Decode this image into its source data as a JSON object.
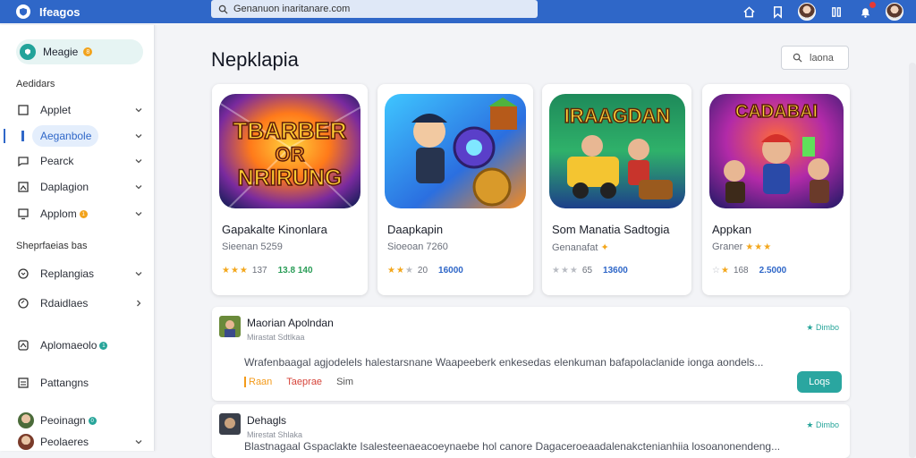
{
  "topbar": {
    "brand": "Ifeagos",
    "search_value": "Genanuon inaritanare.com",
    "icons": [
      "home-icon",
      "bookmark-icon",
      "user-avatar",
      "library-icon",
      "notification-icon",
      "profile-avatar"
    ]
  },
  "sidebar": {
    "header_label": "Meagie",
    "header_badge": "8",
    "section1": "Aedidars",
    "items": [
      {
        "label": "Applet",
        "icon": "square-icon"
      },
      {
        "label": "Aeganbole",
        "icon": "bar-icon",
        "active": true
      },
      {
        "label": "Pearck",
        "icon": "chat-icon"
      },
      {
        "label": "Daplagion",
        "icon": "image-icon"
      },
      {
        "label": "Applom",
        "icon": "monitor-icon",
        "badge": "1"
      }
    ],
    "section2": "Sheprfaeias bas",
    "items2": [
      {
        "label": "Replangias",
        "icon": "refresh-icon"
      },
      {
        "label": "Rdaidlaes",
        "icon": "chat-bubble-icon"
      },
      {
        "label": "Aplomaeolo",
        "icon": "app-icon",
        "badge": "1"
      },
      {
        "label": "Pattangns",
        "icon": "doc-icon"
      },
      {
        "label": "Peoinagn",
        "badge": "0"
      },
      {
        "label": "Peolaeres"
      }
    ]
  },
  "main": {
    "title": "Nepklapia",
    "sort_label": "laona"
  },
  "cards": [
    {
      "title": "Gapakalte Kinonlara",
      "sub": "Sieenan  5259",
      "rating": "137",
      "stars_on": 3,
      "downloads": "13.8 140",
      "dl_color": "#2a9d57",
      "art_title": "TBAREER OR NRIRUNG"
    },
    {
      "title": "Daapkapin",
      "sub": "Sioeoan  7260",
      "rating": "20",
      "stars_on": 2,
      "downloads": "16000",
      "dl_color": "#2f67c8",
      "art_title": ""
    },
    {
      "title": "Som Manatia Sadtogia",
      "sub": "Genanafat",
      "rating": "65",
      "stars_on": 0,
      "downloads": "13600",
      "dl_color": "#2f67c8",
      "art_title": "IRAAGDAN"
    },
    {
      "title": "Appkan",
      "sub": "Graner",
      "rating": "168",
      "stars_on": 1,
      "downloads": "2.5000",
      "dl_color": "#2f67c8",
      "art_title": "CADABAI"
    }
  ],
  "rows": [
    {
      "title": "Maorian Apolndan",
      "sub": "Mirastat  Sdtlkaa",
      "tag": "Dimbo",
      "desc": "Wrafenbaagal agjodelels halestarsnane Waapeeberk enkesedas elenkuman bafapolaclanide ionga aondels...",
      "links": [
        "Raan",
        "Taeprae",
        "Sim"
      ],
      "button": "Loqs"
    },
    {
      "title": "Dehagls",
      "sub": "Mirestat  Shlaka",
      "tag": "Dimbo",
      "desc": "Blastnagaal Gspaclakte Isalesteenaeacoeynaebe hol canore Dagaceroeaadalenakctenianhiia losoanonendeng...",
      "links": [],
      "button": ""
    }
  ]
}
